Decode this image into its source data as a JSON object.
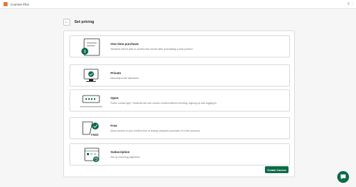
{
  "app": {
    "name": "Courses Plus"
  },
  "header": {
    "title": "Set pricing"
  },
  "options": [
    {
      "title": "One time purchase",
      "description": "Students will be able to access this course after purchasing a paid product",
      "badge": "$"
    },
    {
      "title": "Private",
      "description": "Manually invite attendees"
    },
    {
      "title": "Open",
      "description": "Public course type. Students can see course content without enrolling, signing up and logging in."
    },
    {
      "title": "Free",
      "description": "Allow access to your content free of charge (requires purchase of a free product).",
      "badge": "FREE"
    },
    {
      "title": "Subscription",
      "description": "Set up recurring payments"
    }
  ],
  "actions": {
    "create_label": "Create Course"
  },
  "colors": {
    "accent": "#0c6b46",
    "background": "#f6f6f7"
  },
  "icons": {
    "back": "arrow-left-icon",
    "chat": "chat-bubble-icon",
    "pin": "pin-icon"
  }
}
